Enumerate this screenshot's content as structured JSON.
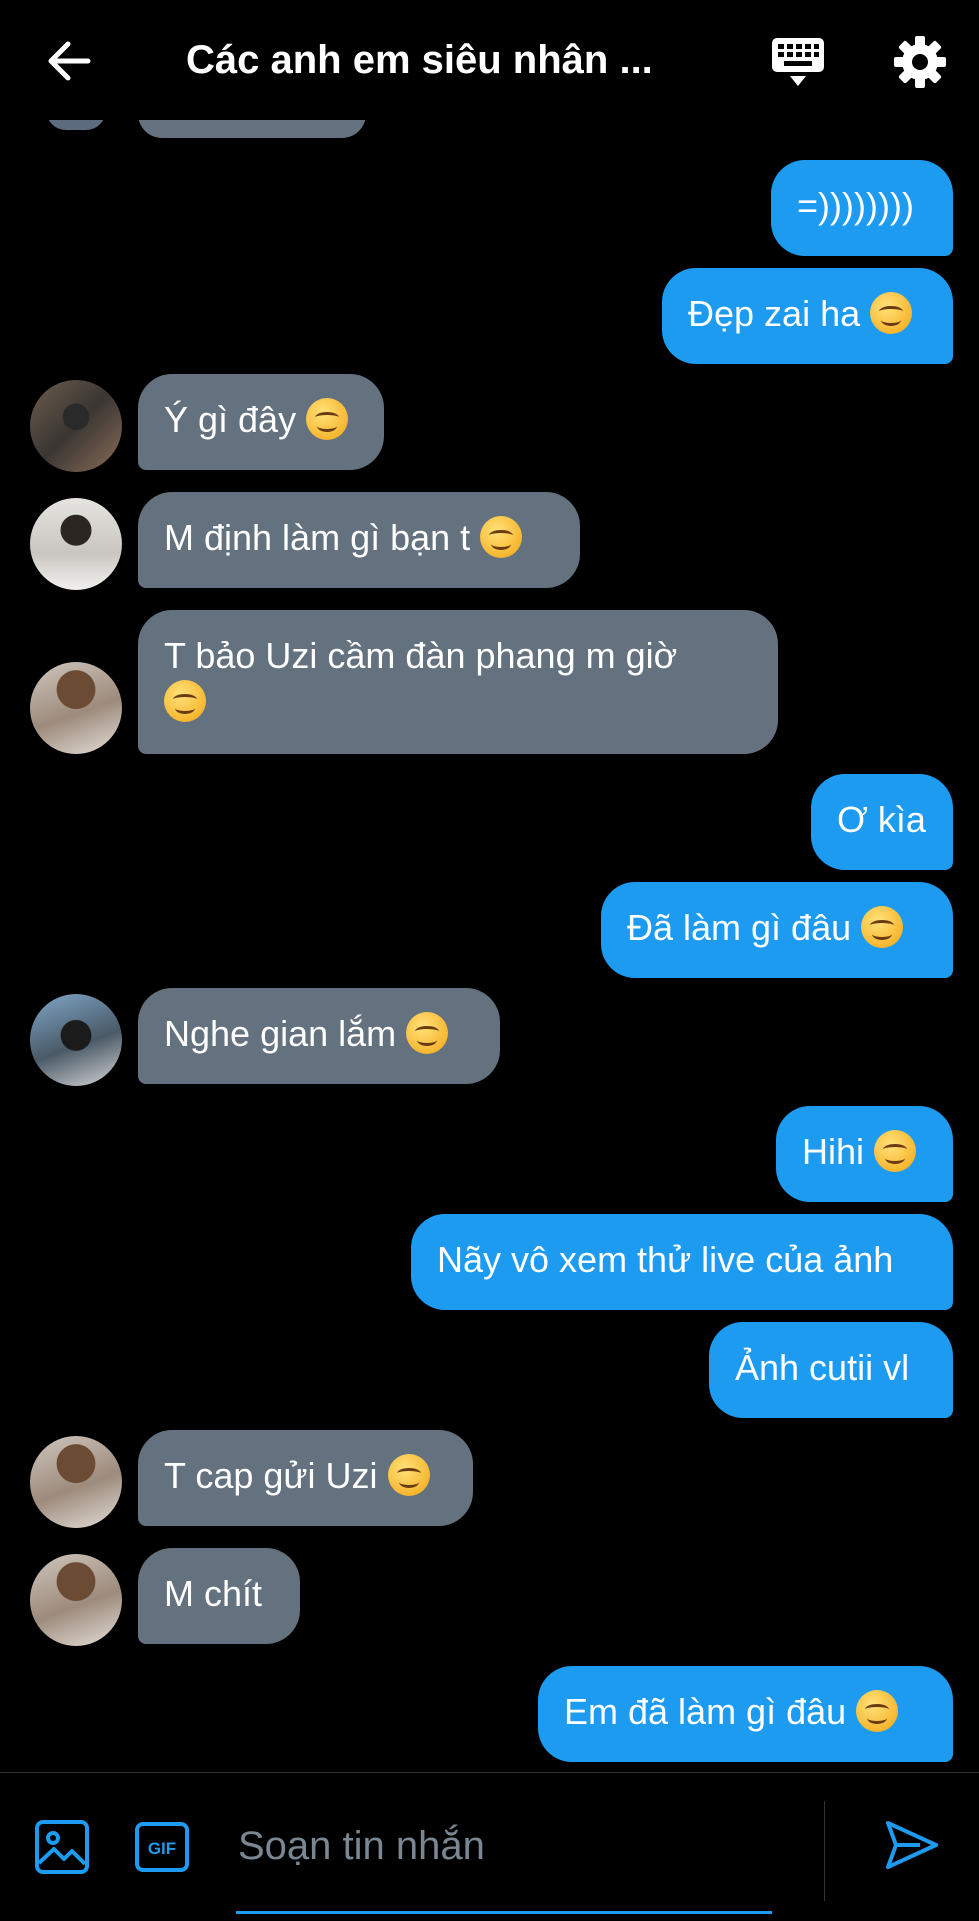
{
  "header": {
    "title": "Các anh em siêu nhân ...",
    "back_icon": "arrow-left-icon",
    "keyboard_icon": "keyboard-icon",
    "settings_icon": "gear-icon"
  },
  "messages": [
    {
      "dir": "out",
      "text": "=))))))))",
      "emoji": false
    },
    {
      "dir": "out",
      "text": "Đẹp zai ha",
      "emoji": true
    },
    {
      "dir": "in",
      "text": "Ý gì đây",
      "emoji": true
    },
    {
      "dir": "in",
      "text": "M định làm gì bạn t",
      "emoji": true
    },
    {
      "dir": "in",
      "text": "T bảo Uzi cầm đàn phang m giờ",
      "emoji": true
    },
    {
      "dir": "out",
      "text": "Ơ kìa",
      "emoji": false
    },
    {
      "dir": "out",
      "text": "Đã làm gì đâu",
      "emoji": true
    },
    {
      "dir": "in",
      "text": "Nghe gian lắm",
      "emoji": true
    },
    {
      "dir": "out",
      "text": "Hihi",
      "emoji": true
    },
    {
      "dir": "out",
      "text": "Nãy vô xem thử live của ảnh",
      "emoji": false
    },
    {
      "dir": "out",
      "text": "Ảnh cutii vl",
      "emoji": false
    },
    {
      "dir": "in",
      "text": "T cap gửi Uzi",
      "emoji": true
    },
    {
      "dir": "in",
      "text": "M chít",
      "emoji": false
    },
    {
      "dir": "out",
      "text": "Em đã làm gì đâu",
      "emoji": true
    }
  ],
  "composer": {
    "placeholder": "Soạn tin nhắn",
    "image_icon": "image-icon",
    "gif_label": "GIF",
    "send_icon": "send-icon"
  },
  "colors": {
    "outgoing_bubble": "#1d9bf0",
    "incoming_bubble": "#64717f",
    "background": "#000000",
    "accent": "#1d9bf0"
  }
}
